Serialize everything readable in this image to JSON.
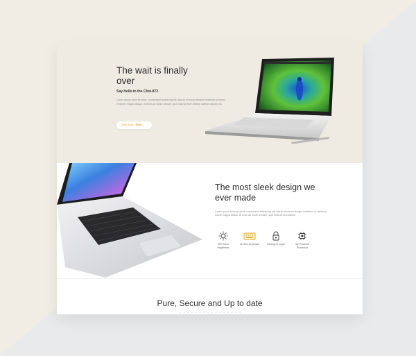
{
  "hero": {
    "title": "The wait is finally over",
    "subtitle": "Say Hello to the Choi-872",
    "text": "Lorem ipsum dolor sit amet, consectetur adipiscing elit, sed do eiusmod tempor incididunt ut labore et dolore magna aliqua. Ut enim ad minim veniam, quis nostrud exer citation ullamco laboris nis.",
    "order_label": "Order Now - ",
    "order_price": "$549",
    "order_arrow": "›"
  },
  "section2": {
    "title": "The most sleek design we ever made",
    "text": "Lorem ipsum dolor sit amet, consectetur adipiscing elit, sed do eiusmod tempor incididunt ut labore et dolore magna aliqua. Ut enim ad minim veniam, quis nostrud exercitation.",
    "features": [
      {
        "icon": "brightness-icon",
        "label": "30% More Brightness"
      },
      {
        "icon": "keyboard-icon",
        "label": "AI New Keyboard"
      },
      {
        "icon": "lock-icon",
        "label": "Intelligent Login"
      },
      {
        "icon": "processor-icon",
        "label": "5X Powerful Processor"
      }
    ]
  },
  "section3": {
    "title": "Pure, Secure and Up to date"
  },
  "colors": {
    "accent": "#e6a21a",
    "hero_bg": "#efebe3",
    "page_bg": "#ebe8e2"
  }
}
